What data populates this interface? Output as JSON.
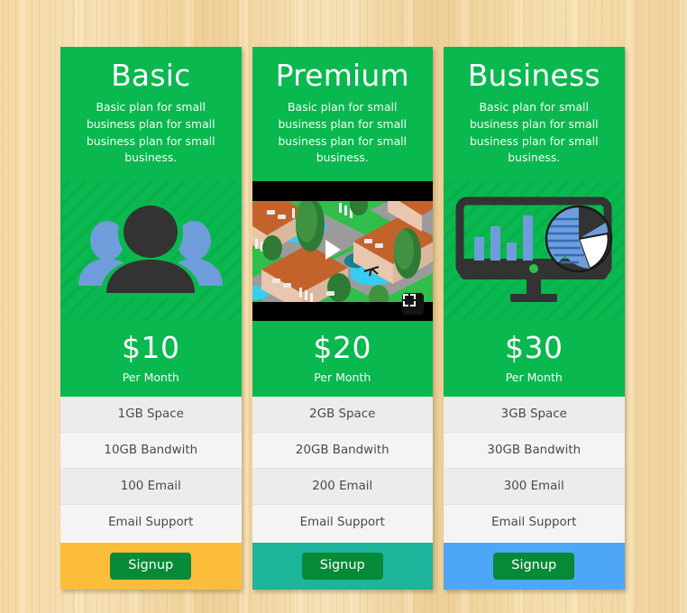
{
  "theme": {
    "green": "#09b84e",
    "button_green": "#078a38",
    "row_odd": "#ececec",
    "row_even": "#f4f4f4",
    "wood": "#f0d49a"
  },
  "plans": [
    {
      "title": "Basic",
      "description": "Basic plan for small business plan for small business plan for small business.",
      "media_kind": "people-illustration",
      "price": "$10",
      "period": "Per Month",
      "features": [
        "1GB Space",
        "10GB Bandwith",
        "100 Email",
        "Email Support"
      ],
      "cta_label": "Signup",
      "footer_color": "#FBBD3A"
    },
    {
      "title": "Premium",
      "description": "Basic plan for small business plan for small business plan for small business.",
      "media_kind": "video-player",
      "video_controls": {
        "play_label": "Play",
        "fullscreen_label": "Fullscreen"
      },
      "price": "$20",
      "period": "Per Month",
      "features": [
        "2GB Space",
        "20GB Bandwith",
        "200 Email",
        "Email Support"
      ],
      "cta_label": "Signup",
      "footer_color": "#1CB49B"
    },
    {
      "title": "Business",
      "description": "Basic plan for small business plan for small business plan for small business.",
      "media_kind": "analytics-monitor-illustration",
      "price": "$30",
      "period": "Per Month",
      "features": [
        "3GB Space",
        "30GB Bandwith",
        "300 Email",
        "Email Support"
      ],
      "cta_label": "Signup",
      "footer_color": "#4EA6F7"
    }
  ]
}
